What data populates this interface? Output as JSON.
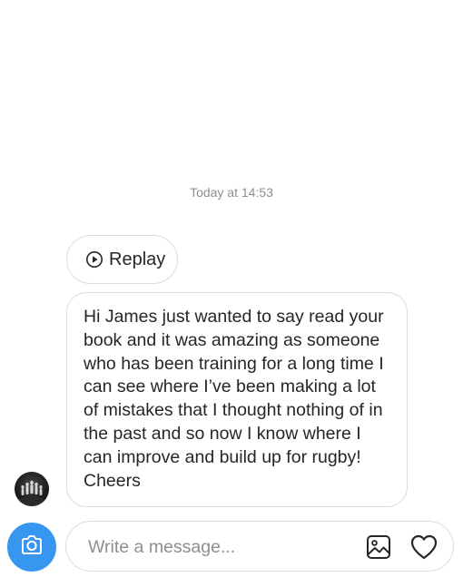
{
  "thread": {
    "timestamp": "Today at 14:53",
    "replay_label": "Replay",
    "message_text": "Hi James just wanted to say read your book and it was amazing as someone who has been training for a long time I can see where I’ve been making a lot of mistakes that I thought nothing of in the past and so now I know where I can improve and build up for rugby! Cheers"
  },
  "composer": {
    "placeholder": "Write a message..."
  },
  "icons": {
    "replay": "play-circle-icon",
    "camera": "camera-icon",
    "gallery": "gallery-icon",
    "like": "heart-icon"
  },
  "colors": {
    "accent": "#3797f0",
    "border": "#dbdbdb",
    "muted_text": "#8e8e8e",
    "text": "#262626"
  }
}
